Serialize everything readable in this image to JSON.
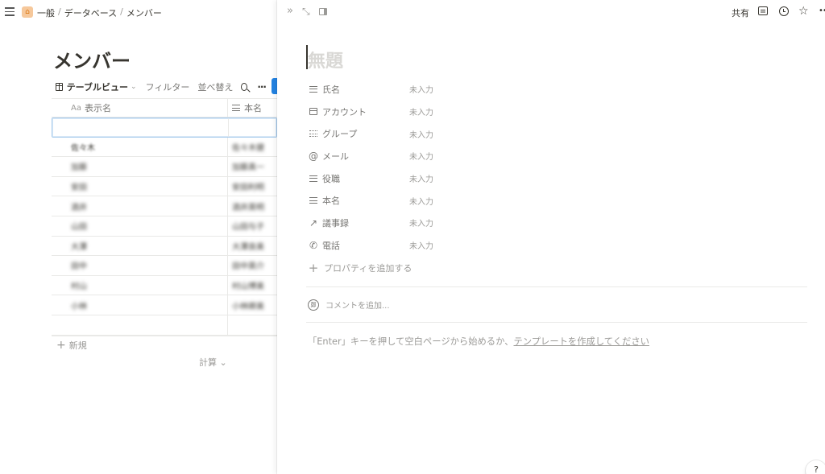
{
  "breadcrumb": {
    "items": [
      "一般",
      "データベース",
      "メンバー"
    ],
    "separator": "/"
  },
  "page": {
    "title": "メンバー",
    "view_name": "テーブルビュー",
    "filter_label": "フィルター",
    "sort_label": "並べ替え",
    "more_label": "···"
  },
  "table": {
    "columns": [
      {
        "icon": "Aa",
        "label": "表示名"
      },
      {
        "icon": "text-lines-icon",
        "label": "本名"
      }
    ],
    "rows": [
      {
        "display": "",
        "real": "",
        "selected": true
      },
      {
        "display": "佐々木",
        "real": "佐々木健"
      },
      {
        "display": "加藤",
        "real": "加藤真一"
      },
      {
        "display": "安田",
        "real": "安田利明"
      },
      {
        "display": "酒井",
        "real": "酒井英明"
      },
      {
        "display": "山田",
        "real": "山田与子"
      },
      {
        "display": "大澤",
        "real": "大澤良美"
      },
      {
        "display": "田中",
        "real": "田中英介"
      },
      {
        "display": "村山",
        "real": "村山博美"
      },
      {
        "display": "小林",
        "real": "小林卿美"
      },
      {
        "display": "",
        "real": ""
      }
    ],
    "new_label": "新規",
    "calc_label": "計算",
    "calc_chevron": "⌄"
  },
  "peek": {
    "toolbar": {
      "collapse_icon": "»",
      "expand_icon": "⤡",
      "share_label": "共有",
      "star_icon": "☆",
      "more_icon": "••"
    },
    "title_placeholder": "無題",
    "properties": [
      {
        "icon": "text-lines-icon",
        "name": "氏名",
        "value": "未入力"
      },
      {
        "icon": "calendar-icon",
        "name": "アカウント",
        "value": "未入力"
      },
      {
        "icon": "bullet-list-icon",
        "name": "グループ",
        "value": "未入力"
      },
      {
        "icon": "at-icon",
        "name": "メール",
        "value": "未入力"
      },
      {
        "icon": "text-lines-icon",
        "name": "役職",
        "value": "未入力"
      },
      {
        "icon": "text-lines-icon",
        "name": "本名",
        "value": "未入力"
      },
      {
        "icon": "arrow-up-right-icon",
        "name": "議事録",
        "value": "未入力"
      },
      {
        "icon": "phone-icon",
        "name": "電話",
        "value": "未入力"
      }
    ],
    "add_property_label": "プロパティを追加する",
    "comment_avatar": "鄭",
    "comment_placeholder": "コメントを追加...",
    "hint_text": "「Enter」キーを押して空白ページから始めるか、",
    "hint_link": "テンプレートを作成してください",
    "help_label": "?"
  },
  "colors": {
    "accent": "#2383e2",
    "text": "#37352f",
    "muted": "#9b9a97",
    "selection_border": "#a7cbed",
    "home_icon_bg": "#f6c89b"
  }
}
